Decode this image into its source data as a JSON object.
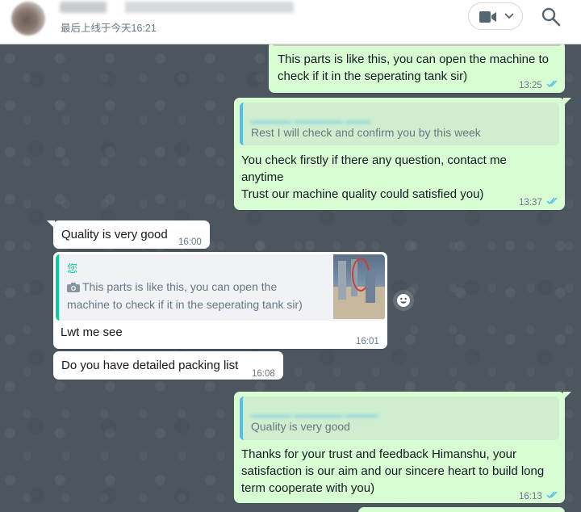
{
  "header": {
    "last_seen": "最后上线于今天16:21"
  },
  "messages": [
    {
      "id": "m1",
      "direction": "out",
      "text_lines": [
        "This parts is like this, you can open the machine to",
        "check if it in the seperating tank sir)"
      ],
      "time": "13:25",
      "status": "read"
    },
    {
      "id": "m2",
      "direction": "out",
      "quote": {
        "text": "Rest I will check and confirm you by this week"
      },
      "text_lines": [
        "You check firstly if there any question, contact me",
        "anytime",
        "Trust our machine quality could satisfied you)"
      ],
      "time": "13:37",
      "status": "read"
    },
    {
      "id": "m3",
      "direction": "in",
      "text": "Quality is very good",
      "time": "16:00"
    },
    {
      "id": "m4",
      "direction": "in",
      "quote": {
        "author": "您",
        "text_lines": [
          "This parts is like this, you can open the",
          "machine to check if it in the seperating tank sir)"
        ]
      },
      "text": "Lwt me see",
      "time": "16:01"
    },
    {
      "id": "m5",
      "direction": "in",
      "text": "Do you have detailed packing list",
      "time": "16:08"
    },
    {
      "id": "m6",
      "direction": "out",
      "quote": {
        "text": "Quality is very good"
      },
      "text_lines": [
        "Thanks for your trust and feedback Himanshu, your",
        "satisfaction is our aim and our sincere heart to build long",
        "term cooperate with you)"
      ],
      "time": "16:13",
      "status": "read"
    }
  ],
  "colors": {
    "outgoing_bubble": "#d9fdd3",
    "incoming_bubble": "#ffffff",
    "read_ticks": "#53bdeb",
    "chat_background": "#4b565e"
  },
  "icons": [
    "video-call-icon",
    "chevron-down-icon",
    "search-icon",
    "camera-icon",
    "smiley-icon",
    "double-check-icon"
  ]
}
